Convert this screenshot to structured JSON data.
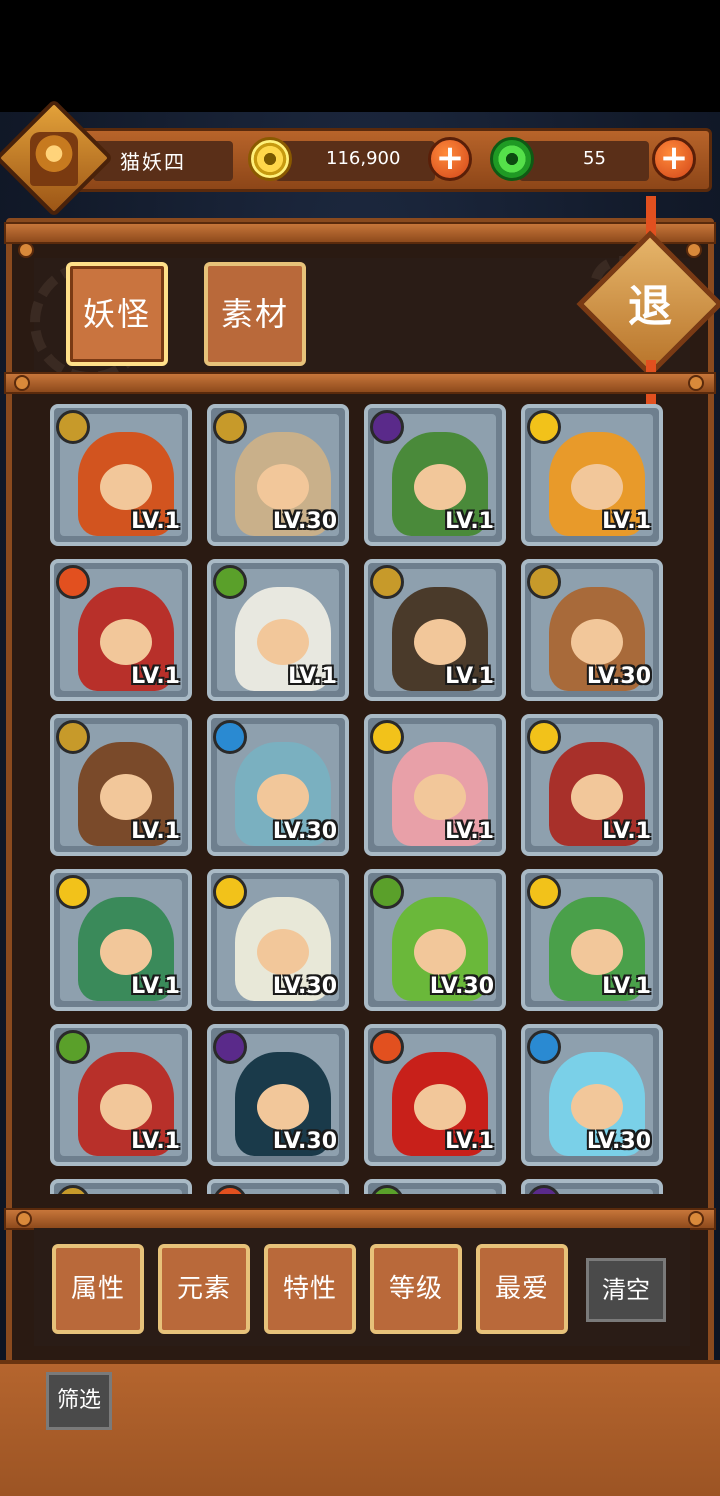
{
  "player": {
    "name": "猫妖四"
  },
  "resources": {
    "gold": {
      "icon": "gold-coin-icon",
      "amount": "116,900"
    },
    "jade": {
      "icon": "jade-coin-icon",
      "amount": "55"
    }
  },
  "tabs": [
    {
      "label": "妖怪",
      "active": true
    },
    {
      "label": "素材",
      "active": false
    }
  ],
  "exit_label": "退",
  "element_colors": {
    "earth": "#c79a2a",
    "dark": "#5a2a8a",
    "light": "#f2c21a",
    "fire": "#e2501f",
    "wood": "#5aa02a",
    "water": "#2a8ad2"
  },
  "monsters": [
    {
      "element": "earth",
      "level": "LV.1",
      "color": "#d2541f"
    },
    {
      "element": "earth",
      "level": "LV.30",
      "color": "#c9b08a"
    },
    {
      "element": "dark",
      "level": "LV.1",
      "color": "#4a8a3a"
    },
    {
      "element": "light",
      "level": "LV.1",
      "color": "#e89a2a"
    },
    {
      "element": "fire",
      "level": "LV.1",
      "color": "#b8302a"
    },
    {
      "element": "wood",
      "level": "LV.1",
      "color": "#e8e8e0"
    },
    {
      "element": "earth",
      "level": "LV.1",
      "color": "#4a3a2a"
    },
    {
      "element": "earth",
      "level": "LV.30",
      "color": "#a86a3a"
    },
    {
      "element": "earth",
      "level": "LV.1",
      "color": "#7a4a2a"
    },
    {
      "element": "water",
      "level": "LV.30",
      "color": "#7ab0c0"
    },
    {
      "element": "light",
      "level": "LV.1",
      "color": "#e8a0a8"
    },
    {
      "element": "light",
      "level": "LV.1",
      "color": "#a8302a"
    },
    {
      "element": "light",
      "level": "LV.1",
      "color": "#3a8a5a"
    },
    {
      "element": "light",
      "level": "LV.30",
      "color": "#e8e8d8"
    },
    {
      "element": "wood",
      "level": "LV.30",
      "color": "#6ab83a"
    },
    {
      "element": "light",
      "level": "LV.1",
      "color": "#4aa04a"
    },
    {
      "element": "wood",
      "level": "LV.1",
      "color": "#b8302a"
    },
    {
      "element": "dark",
      "level": "LV.30",
      "color": "#1a3a4a"
    },
    {
      "element": "fire",
      "level": "LV.1",
      "color": "#c8201a"
    },
    {
      "element": "water",
      "level": "LV.30",
      "color": "#7ad0e8"
    },
    {
      "element": "earth",
      "level": "",
      "color": "#c98a3a"
    },
    {
      "element": "fire",
      "level": "",
      "color": "#d84a3a"
    },
    {
      "element": "wood",
      "level": "",
      "color": "#6ac84a"
    },
    {
      "element": "dark",
      "level": "",
      "color": "#a06a3a"
    }
  ],
  "filters": [
    {
      "label": "属性"
    },
    {
      "label": "元素"
    },
    {
      "label": "特性"
    },
    {
      "label": "等级"
    },
    {
      "label": "最爱"
    }
  ],
  "clear_label": "清空",
  "screen_label": "筛选"
}
